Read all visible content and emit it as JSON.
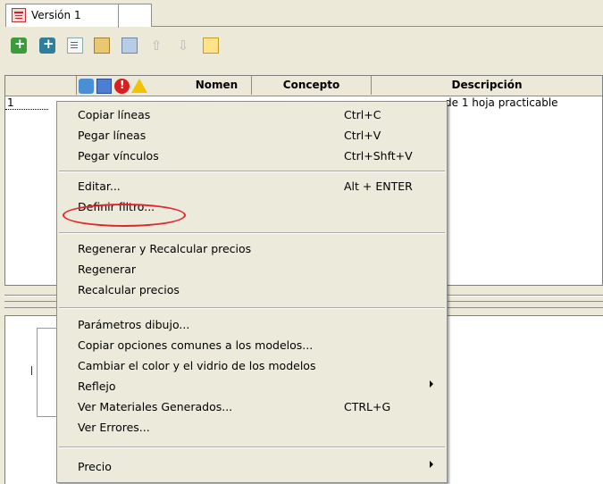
{
  "tabs": [
    {
      "label": "Versión 1",
      "icon": "document-red-icon"
    }
  ],
  "toolbar": {
    "icons": [
      "add-line-icon",
      "add-line-alt-icon",
      "copy-document-icon",
      "paste-icon",
      "paste-link-icon",
      "move-up-arrow-icon",
      "move-down-arrow-icon",
      "filter-icon"
    ]
  },
  "grid": {
    "header": {
      "icons": [
        "model-icon",
        "book-icon",
        "error-icon",
        "warning-icon"
      ],
      "columns": [
        "Nomen",
        "Concepto",
        "Descripción"
      ]
    },
    "rows": [
      {
        "num": "1",
        "descripcion": "de 1 hoja practicable"
      }
    ]
  },
  "menu": {
    "items": [
      {
        "label": "Copiar líneas",
        "shortcut": "Ctrl+C"
      },
      {
        "label": "Pegar líneas",
        "shortcut": "Ctrl+V"
      },
      {
        "label": "Pegar vínculos",
        "shortcut": "Ctrl+Shft+V"
      },
      {
        "label": "Editar...",
        "shortcut": "Alt + ENTER"
      },
      {
        "label": "Definir filtro...",
        "shortcut": ""
      },
      {
        "label": "Regenerar y Recalcular precios",
        "shortcut": ""
      },
      {
        "label": "Regenerar",
        "shortcut": ""
      },
      {
        "label": "Recalcular precios",
        "shortcut": ""
      },
      {
        "label": "Parámetros dibujo...",
        "shortcut": ""
      },
      {
        "label": "Copiar opciones comunes a los modelos...",
        "shortcut": ""
      },
      {
        "label": "Cambiar el color y el vidrio de los modelos",
        "shortcut": ""
      },
      {
        "label": "Reflejo",
        "shortcut": "",
        "submenu": true
      },
      {
        "label": "Ver Materiales Generados...",
        "shortcut": "CTRL+G"
      },
      {
        "label": "Ver Errores...",
        "shortcut": ""
      },
      {
        "label": "Precio",
        "shortcut": "",
        "submenu": true
      }
    ],
    "highlight_color": "#e3242b"
  }
}
